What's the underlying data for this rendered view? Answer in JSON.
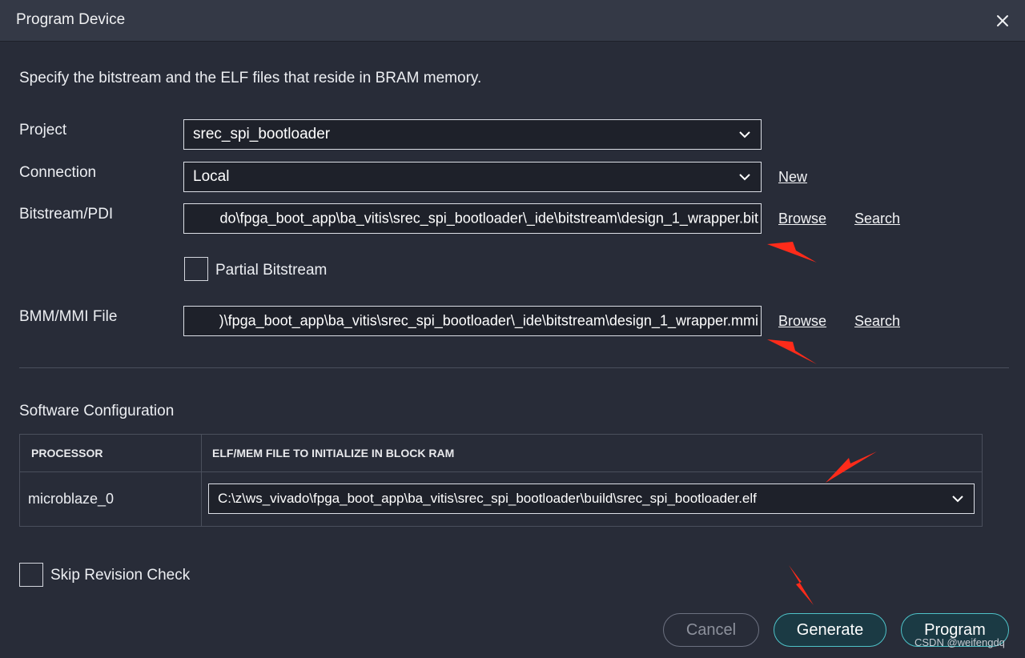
{
  "dialog": {
    "title": "Program Device",
    "description": "Specify the bitstream and the ELF files that reside in BRAM memory."
  },
  "form": {
    "project_label": "Project",
    "project_value": "srec_spi_bootloader",
    "connection_label": "Connection",
    "connection_value": "Local",
    "connection_new_link": "New",
    "bitstream_label": "Bitstream/PDI",
    "bitstream_value": "do\\fpga_boot_app\\ba_vitis\\srec_spi_bootloader\\_ide\\bitstream\\design_1_wrapper.bit",
    "bitstream_browse": "Browse",
    "bitstream_search": "Search",
    "partial_bitstream_label": "Partial Bitstream",
    "partial_bitstream_checked": false,
    "bmm_label": "BMM/MMI File",
    "bmm_value": ")\\fpga_boot_app\\ba_vitis\\srec_spi_bootloader\\_ide\\bitstream\\design_1_wrapper.mmi",
    "bmm_browse": "Browse",
    "bmm_search": "Search"
  },
  "software": {
    "section_title": "Software Configuration",
    "columns": [
      "PROCESSOR",
      "ELF/MEM FILE TO INITIALIZE IN BLOCK RAM"
    ],
    "rows": [
      {
        "processor": "microblaze_0",
        "elf_file": "C:\\z\\ws_vivado\\fpga_boot_app\\ba_vitis\\srec_spi_bootloader\\build\\srec_spi_bootloader.elf"
      }
    ]
  },
  "skip_revision": {
    "label": "Skip Revision Check",
    "checked": false
  },
  "buttons": {
    "cancel": "Cancel",
    "generate": "Generate",
    "program": "Program"
  },
  "watermark": "CSDN @weifengdq",
  "colors": {
    "background": "#282c38",
    "titlebar": "#343946",
    "accent": "#4ec2c8",
    "annotation_arrow": "#ff2b1a"
  },
  "icons": {
    "close": "close-icon",
    "dropdown": "chevron-down-icon"
  }
}
